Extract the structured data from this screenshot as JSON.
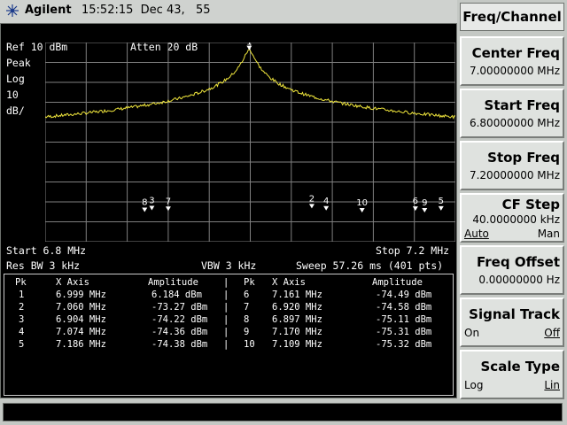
{
  "header": {
    "brand": "Agilent",
    "time": "15:52:15  Dec 43,   55"
  },
  "screen": {
    "ref": "Ref 10 dBm",
    "atten": "Atten 20 dB",
    "detector": "Peak",
    "scale_type": "Log",
    "scale_value": "10",
    "scale_unit": "dB/",
    "start": "Start 6.8 MHz",
    "stop": "Stop 7.2 MHz",
    "res_bw": "Res BW 3 kHz",
    "vbw": "VBW 3 kHz",
    "sweep": "Sweep 57.26 ms (401 pts)"
  },
  "chart_data": {
    "type": "line",
    "x_range_mhz": [
      6.8,
      7.2
    ],
    "y_range_dbm": [
      -90,
      10
    ],
    "grid": true,
    "trace_color": "#f0e63c",
    "markers": [
      {
        "pk": "1",
        "x": "6.999 MHz",
        "amp": "6.184 dBm",
        "x_mhz": 6.999,
        "dbm": 6.184
      },
      {
        "pk": "2",
        "x": "7.060 MHz",
        "amp": "-73.27 dBm",
        "x_mhz": 7.06,
        "dbm": -73.27
      },
      {
        "pk": "3",
        "x": "6.904 MHz",
        "amp": "-74.22 dBm",
        "x_mhz": 6.904,
        "dbm": -74.22
      },
      {
        "pk": "4",
        "x": "7.074 MHz",
        "amp": "-74.36 dBm",
        "x_mhz": 7.074,
        "dbm": -74.36
      },
      {
        "pk": "5",
        "x": "7.186 MHz",
        "amp": "-74.38 dBm",
        "x_mhz": 7.186,
        "dbm": -74.38
      },
      {
        "pk": "6",
        "x": "7.161 MHz",
        "amp": "-74.49 dBm",
        "x_mhz": 7.161,
        "dbm": -74.49
      },
      {
        "pk": "7",
        "x": "6.920 MHz",
        "amp": "-74.58 dBm",
        "x_mhz": 6.92,
        "dbm": -74.58
      },
      {
        "pk": "8",
        "x": "6.897 MHz",
        "amp": "-75.11 dBm",
        "x_mhz": 6.897,
        "dbm": -75.11
      },
      {
        "pk": "9",
        "x": "7.170 MHz",
        "amp": "-75.31 dBm",
        "x_mhz": 7.17,
        "dbm": -75.31
      },
      {
        "pk": "10",
        "x": "7.109 MHz",
        "amp": "-75.32 dBm",
        "x_mhz": 7.109,
        "dbm": -75.32
      }
    ]
  },
  "table": {
    "h_pk": "Pk",
    "h_x": "X Axis",
    "h_amp": "Amplitude",
    "sep": "|"
  },
  "menu": {
    "title": "Freq/Channel",
    "center": {
      "label": "Center Freq",
      "value": "7.00000000 MHz"
    },
    "start": {
      "label": "Start Freq",
      "value": "6.80000000 MHz"
    },
    "stop": {
      "label": "Stop Freq",
      "value": "7.20000000 MHz"
    },
    "cf_step": {
      "label": "CF Step",
      "value": "40.0000000 kHz",
      "opt1": "Auto",
      "opt2": "Man"
    },
    "offset": {
      "label": "Freq Offset",
      "value": "0.00000000  Hz"
    },
    "signal_track": {
      "label": "Signal Track",
      "opt1": "On",
      "opt2": "Off"
    },
    "scale_type": {
      "label": "Scale Type",
      "opt1": "Log",
      "opt2": "Lin"
    }
  }
}
